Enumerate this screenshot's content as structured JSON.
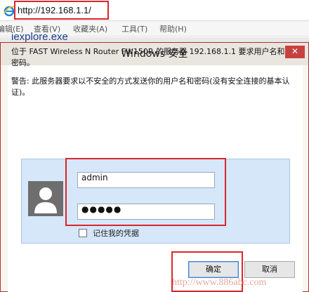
{
  "browser": {
    "url": "http://192.168.1.1/",
    "menu": [
      "编辑(E)",
      "查看(V)",
      "收藏夹(A)",
      "工具(T)",
      "帮助(H)"
    ]
  },
  "dialog": {
    "title": "Windows 安全",
    "close_symbol": "✕",
    "app_name": "iexplore.exe",
    "server_message": "位于 FAST Wireless N Router FW150R 的服务器 192.168.1.1 要求用户名和密码。",
    "warning_message": "警告: 此服务器要求以不安全的方式发送你的用户名和密码(没有安全连接的基本认证)。",
    "username_value": "admin",
    "password_mask": "●●●●●",
    "remember_label": "记住我的凭据",
    "ok_label": "确定",
    "cancel_label": "取消"
  },
  "watermark": "http://www.886abc.com",
  "icons": {
    "browser": "internet-explorer-icon",
    "avatar": "user-silhouette-icon",
    "close": "close-icon"
  },
  "colors": {
    "highlight": "#d9262c",
    "close_button": "#c7423e",
    "credential_tile": "#d5e7f9",
    "app_name": "#1c3f8a"
  }
}
